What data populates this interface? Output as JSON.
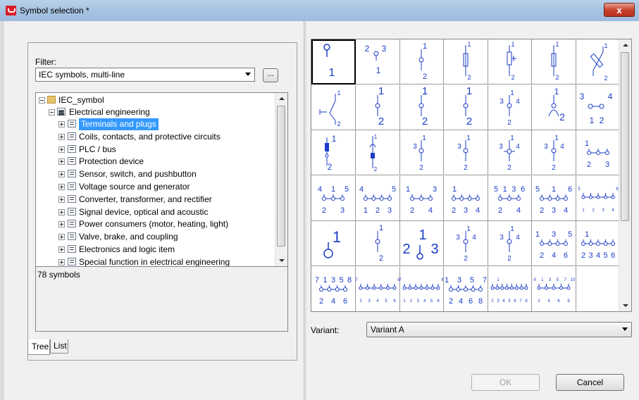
{
  "window": {
    "title": "Symbol selection *",
    "close_label": "x"
  },
  "filter": {
    "label": "Filter:",
    "value": "IEC symbols, multi-line",
    "more_button": "..."
  },
  "tree": {
    "root": "IEC_symbol",
    "group": "Electrical engineering",
    "items": [
      "Terminals and plugs",
      "Coils, contacts, and protective circuits",
      "PLC / bus",
      "Protection device",
      "Sensor, switch, and pushbutton",
      "Voltage source and generator",
      "Converter, transformer, and rectifier",
      "Signal device, optical and acoustic",
      "Power consumers (motor, heating, light)",
      "Valve, brake, and coupling",
      "Electronics and logic item",
      "Special function in electrical engineering"
    ],
    "selected_index": 0
  },
  "status": {
    "symbol_count": "78 symbols"
  },
  "tabs": [
    {
      "label": "Tree",
      "active": true
    },
    {
      "label": "List",
      "active": false
    }
  ],
  "variant": {
    "label": "Variant:",
    "value": "Variant A"
  },
  "buttons": {
    "ok": "OK",
    "cancel": "Cancel"
  },
  "symbols": [
    {
      "t": "pin",
      "top": [],
      "bottom": [
        "1"
      ],
      "big": true
    },
    {
      "t": "pin",
      "top": [
        "2",
        "3"
      ],
      "bottom": [
        "1"
      ]
    },
    {
      "t": "term",
      "top": [
        "1"
      ],
      "bottom": [
        "2"
      ]
    },
    {
      "t": "fuse",
      "top": [
        "1"
      ],
      "bottom": [
        "2"
      ]
    },
    {
      "t": "fuse2",
      "top": [
        "1"
      ],
      "bottom": [
        "2"
      ]
    },
    {
      "t": "fuse",
      "top": [
        "1"
      ],
      "bottom": [
        "2"
      ]
    },
    {
      "t": "diag",
      "top": [
        "1"
      ],
      "bottom": [
        "2"
      ]
    },
    {
      "t": "switch",
      "top": [
        "1"
      ],
      "bottom": [
        "2"
      ]
    },
    {
      "t": "term",
      "top": [
        "1"
      ],
      "bottom": [
        "2"
      ],
      "big": true
    },
    {
      "t": "term",
      "top": [
        "1"
      ],
      "bottom": [
        "2"
      ],
      "big": true
    },
    {
      "t": "term",
      "top": [
        "1"
      ],
      "bottom": [
        "2"
      ],
      "big": true
    },
    {
      "t": "term3",
      "top": [
        "3",
        "1",
        "4"
      ],
      "bottom": [
        "2"
      ]
    },
    {
      "t": "plug",
      "top": [
        "1"
      ],
      "bottom": [
        "2"
      ]
    },
    {
      "t": "h2",
      "top": [
        "3",
        "4"
      ],
      "bottom": [
        "1",
        "2"
      ]
    },
    {
      "t": "block",
      "top": [
        "1"
      ],
      "bottom": [
        "2"
      ]
    },
    {
      "t": "block2",
      "top": [
        "1"
      ],
      "bottom": [
        "2"
      ]
    },
    {
      "t": "term3",
      "top": [
        "3",
        "1"
      ],
      "bottom": [
        "2"
      ]
    },
    {
      "t": "term3",
      "top": [
        "3",
        "1"
      ],
      "bottom": [
        "2"
      ]
    },
    {
      "t": "cross",
      "top": [
        "3",
        "1",
        "4"
      ],
      "bottom": [
        "2"
      ]
    },
    {
      "t": "term3",
      "top": [
        "3",
        "1",
        "4"
      ],
      "bottom": [
        "2"
      ]
    },
    {
      "t": "chain",
      "n": 2,
      "top": [
        "1"
      ],
      "bottom": [
        "2",
        "3"
      ]
    },
    {
      "t": "chain",
      "n": 2,
      "top": [
        "4",
        "1",
        "5"
      ],
      "bottom": [
        "2",
        "3"
      ]
    },
    {
      "t": "chain",
      "n": 3,
      "top": [
        "4",
        "5"
      ],
      "bottom": [
        "1",
        "2",
        "3"
      ]
    },
    {
      "t": "chain",
      "n": 2,
      "top": [
        "1",
        "3"
      ],
      "bottom": [
        "2",
        "4"
      ]
    },
    {
      "t": "chain",
      "n": 3,
      "top": [
        "1"
      ],
      "bottom": [
        "2",
        "3",
        "4"
      ]
    },
    {
      "t": "chain",
      "n": 2,
      "top": [
        "5",
        "1",
        "3",
        "6"
      ],
      "bottom": [
        "2",
        "4"
      ]
    },
    {
      "t": "chain",
      "n": 3,
      "top": [
        "5",
        "1",
        "6"
      ],
      "bottom": [
        "2",
        "3",
        "4"
      ]
    },
    {
      "t": "chain",
      "n": 4,
      "top": [
        "5",
        "6"
      ],
      "bottom": [
        "1",
        "2",
        "3",
        "4"
      ],
      "small": true
    },
    {
      "t": "bigpin",
      "top": [
        "1"
      ],
      "bottom": []
    },
    {
      "t": "term",
      "top": [
        "1"
      ],
      "bottom": [
        "2"
      ]
    },
    {
      "t": "bigpin2",
      "top": [
        "2",
        "1",
        "3"
      ],
      "bottom": []
    },
    {
      "t": "term3",
      "top": [
        "3",
        "1",
        "4"
      ],
      "bottom": [
        "2"
      ]
    },
    {
      "t": "term3",
      "top": [
        "3",
        "1",
        "4"
      ],
      "bottom": [
        "2"
      ]
    },
    {
      "t": "chain",
      "n": 3,
      "top": [
        "1",
        "3",
        "5"
      ],
      "bottom": [
        "2",
        "4",
        "6"
      ]
    },
    {
      "t": "chain",
      "n": 4,
      "top": [
        "1"
      ],
      "bottom": [
        "2",
        "3",
        "4",
        "5",
        "6"
      ]
    },
    {
      "t": "chain",
      "n": 3,
      "top": [
        "7",
        "1",
        "3",
        "5",
        "8"
      ],
      "bottom": [
        "2",
        "4",
        "6"
      ]
    },
    {
      "t": "chain",
      "n": 5,
      "top": [
        "7",
        "8"
      ],
      "bottom": [
        "2",
        "3",
        "4",
        "5",
        "6"
      ],
      "small": true
    },
    {
      "t": "chain",
      "n": 6,
      "top": [
        "7",
        "8"
      ],
      "bottom": [
        "1",
        "2",
        "3",
        "4",
        "5",
        "6"
      ],
      "small": true
    },
    {
      "t": "chain",
      "n": 4,
      "top": [
        "1",
        "3",
        "5",
        "7"
      ],
      "bottom": [
        "2",
        "4",
        "6",
        "8"
      ]
    },
    {
      "t": "chain",
      "n": 7,
      "top": [
        "1"
      ],
      "bottom": [
        "2",
        "3",
        "4",
        "5",
        "6",
        "7",
        "8"
      ],
      "small": true
    },
    {
      "t": "chain",
      "n": 4,
      "top": [
        "9",
        "1",
        "3",
        "5",
        "7",
        "10"
      ],
      "bottom": [
        "2",
        "4",
        "6",
        "8"
      ],
      "small": true
    }
  ]
}
